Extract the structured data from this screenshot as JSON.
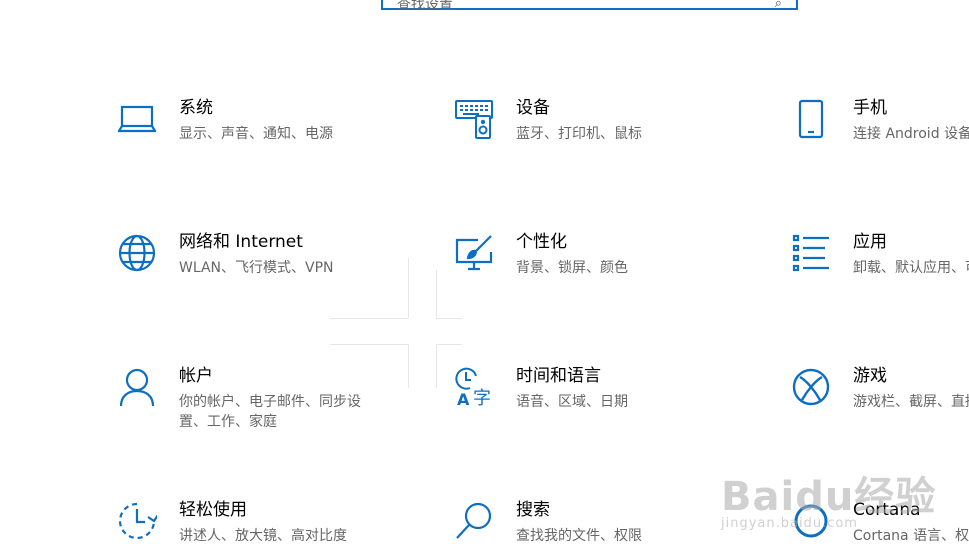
{
  "search": {
    "placeholder": "查找设置"
  },
  "accent_color": "#0e6fc2",
  "tiles": [
    {
      "title": "系统",
      "desc": "显示、声音、通知、电源",
      "icon": "laptop-icon"
    },
    {
      "title": "设备",
      "desc": "蓝牙、打印机、鼠标",
      "icon": "devices-icon"
    },
    {
      "title": "手机",
      "desc": "连接 Android 设备和 iPhone",
      "icon": "phone-icon"
    },
    {
      "title": "网络和 Internet",
      "desc": "WLAN、飞行模式、VPN",
      "icon": "globe-icon"
    },
    {
      "title": "个性化",
      "desc": "背景、锁屏、颜色",
      "icon": "personalization-icon"
    },
    {
      "title": "应用",
      "desc": "卸载、默认应用、可选功能",
      "icon": "apps-list-icon"
    },
    {
      "title": "帐户",
      "desc": "你的帐户、电子邮件、同步设",
      "desc2": "置、工作、家庭",
      "icon": "person-icon"
    },
    {
      "title": "时间和语言",
      "desc": "语音、区域、日期",
      "icon": "time-language-icon"
    },
    {
      "title": "游戏",
      "desc": "游戏栏、截屏、直播、游戏模式",
      "icon": "xbox-icon"
    },
    {
      "title": "轻松使用",
      "desc": "讲述人、放大镜、高对比度",
      "icon": "ease-of-access-icon"
    },
    {
      "title": "搜索",
      "desc": "查找我的文件、权限",
      "icon": "search-icon"
    },
    {
      "title": "Cortana",
      "desc": "Cortana 语言、权限、通知",
      "icon": "cortana-icon"
    }
  ],
  "watermark": {
    "main": "Baidu经验",
    "sub": "jingyan.baidu.com"
  }
}
